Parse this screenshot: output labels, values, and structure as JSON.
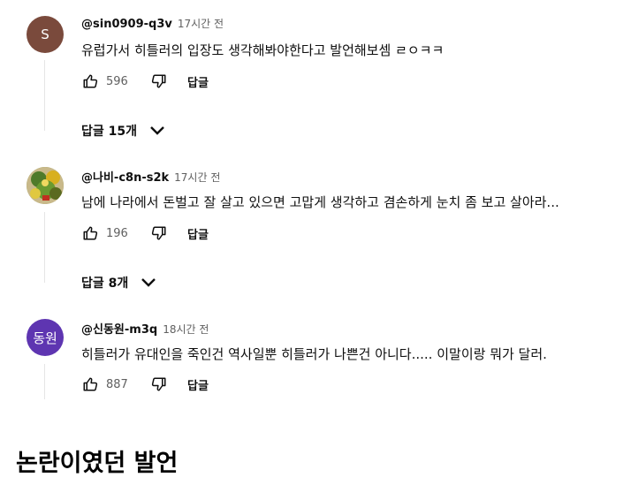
{
  "comments": [
    {
      "avatar_letter": "S",
      "avatar_color": "#7a4a3c",
      "author": "@sin0909-q3v",
      "time": "17시간 전",
      "text": "유럽가서 히틀러의 입장도 생각해봐야한다고 발언해보셈 ㄹㅇㅋㅋ",
      "likes": "596",
      "reply_label": "답글",
      "replies_label": "답글 15개"
    },
    {
      "avatar_letter": "",
      "avatar_color": "#7b8a3a",
      "author": "@나비-c8n-s2k",
      "time": "17시간 전",
      "text": "남에 나라에서 돈벌고 잘 살고 있으면 고맙게 생각하고 겸손하게 눈치 좀 보고 살아라...",
      "likes": "196",
      "reply_label": "답글",
      "replies_label": "답글 8개"
    },
    {
      "avatar_letter": "동원",
      "avatar_color": "#5e35b1",
      "author": "@신동원-m3q",
      "time": "18시간 전",
      "text": "히틀러가 유대인을 죽인건 역사일뿐 히틀러가 나쁜건 아니다.....  이말이랑 뭐가 달러.",
      "likes": "887",
      "reply_label": "답글",
      "replies_label": ""
    }
  ],
  "caption": "논란이였던 발언",
  "icons": {
    "like": "thumbs-up-icon",
    "dislike": "thumbs-down-icon",
    "expand": "chevron-down-icon"
  }
}
